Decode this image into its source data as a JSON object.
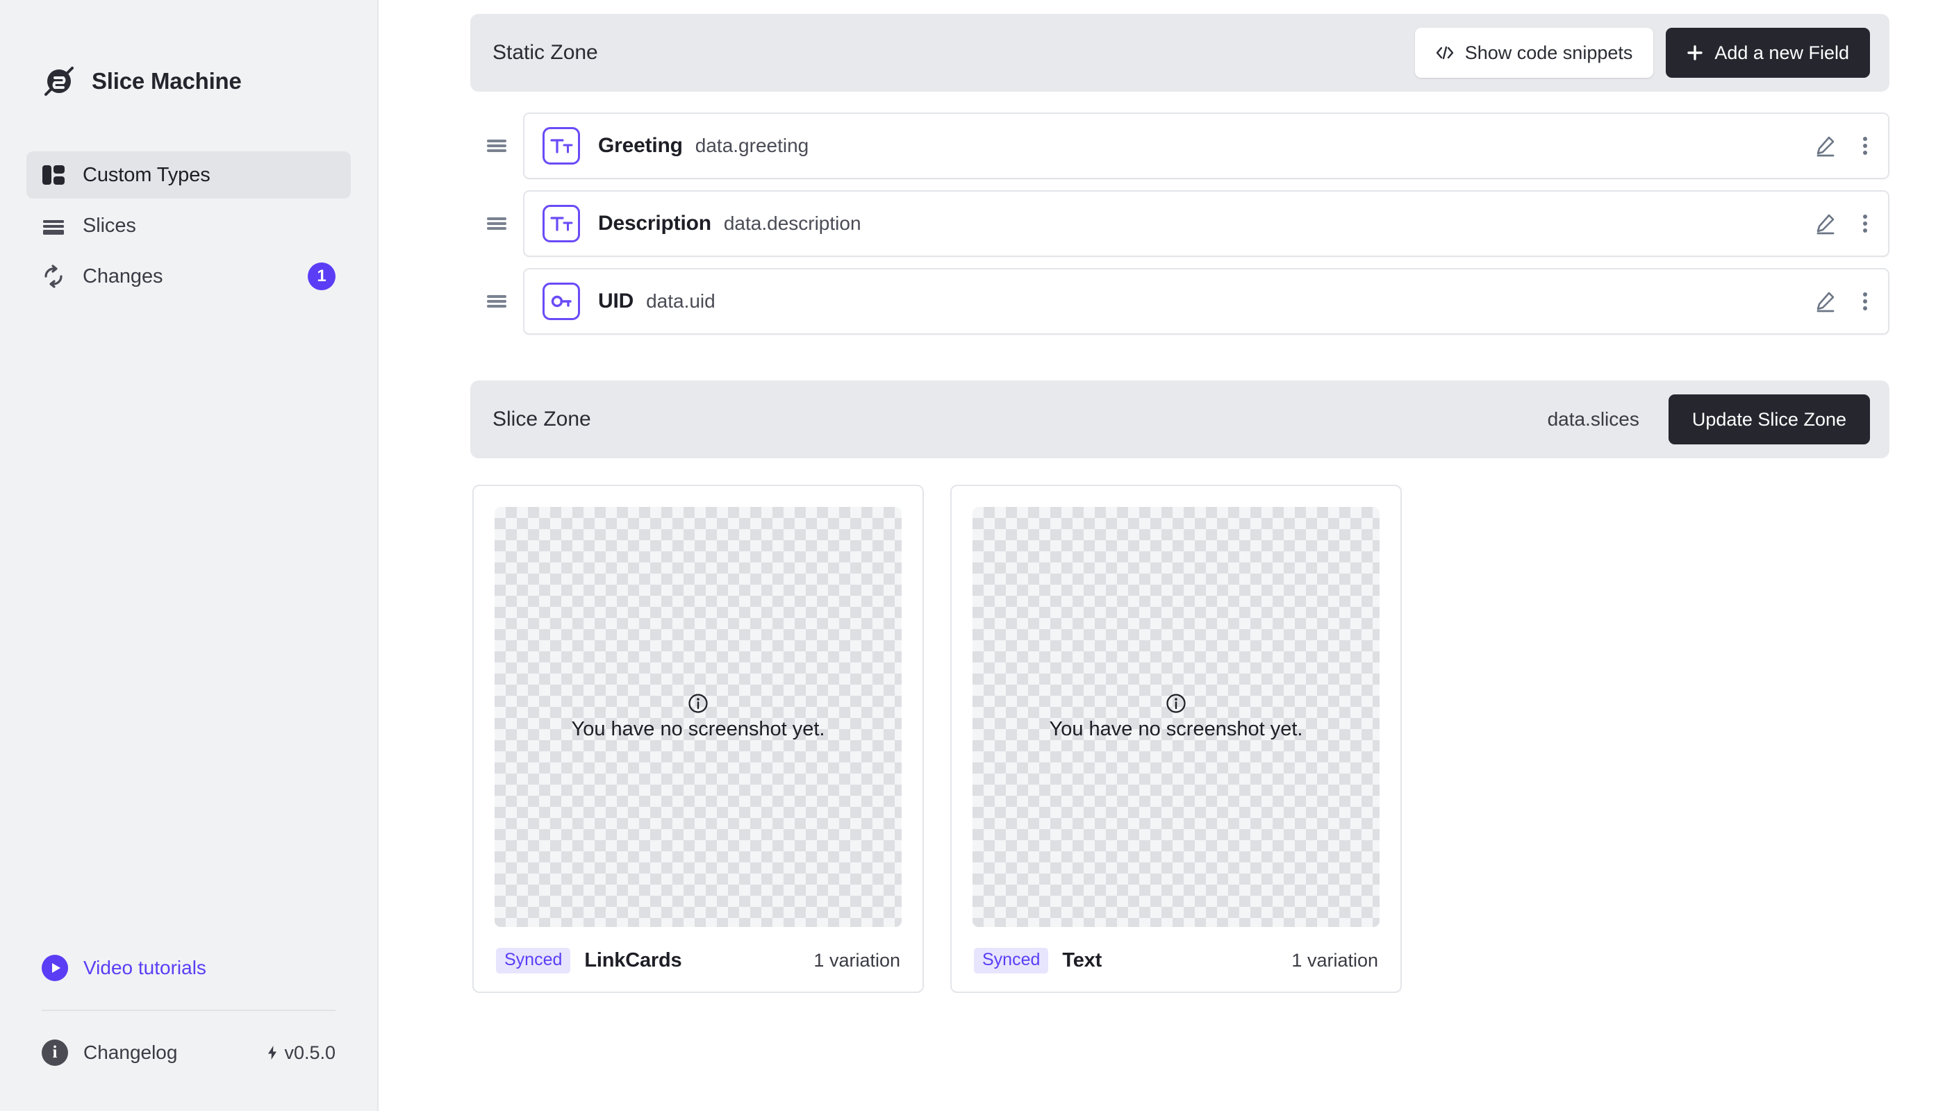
{
  "app": {
    "brand_name": "Slice Machine",
    "accent_color": "#5B3DF5",
    "dark_color": "#25262E"
  },
  "sidebar": {
    "nav_items": [
      {
        "label": "Custom Types",
        "icon": "layout-icon",
        "active": true
      },
      {
        "label": "Slices",
        "icon": "slices-icon",
        "active": false
      },
      {
        "label": "Changes",
        "icon": "sync-icon",
        "active": false,
        "badge": "1"
      }
    ],
    "video_tutorials_label": "Video tutorials",
    "changelog_label": "Changelog",
    "version": "v0.5.0"
  },
  "static_zone": {
    "title": "Static Zone",
    "show_code_snippets_label": "Show code snippets",
    "add_field_label": "Add a new Field",
    "fields": [
      {
        "name": "Greeting",
        "path": "data.greeting",
        "icon": "text-field-icon"
      },
      {
        "name": "Description",
        "path": "data.description",
        "icon": "text-field-icon"
      },
      {
        "name": "UID",
        "path": "data.uid",
        "icon": "key-icon"
      }
    ]
  },
  "slice_zone": {
    "title": "Slice Zone",
    "data_path": "data.slices",
    "update_label": "Update Slice Zone",
    "placeholder_message": "You have no screenshot yet.",
    "slices": [
      {
        "status": "Synced",
        "name": "LinkCards",
        "variations": "1 variation"
      },
      {
        "status": "Synced",
        "name": "Text",
        "variations": "1 variation"
      }
    ]
  }
}
